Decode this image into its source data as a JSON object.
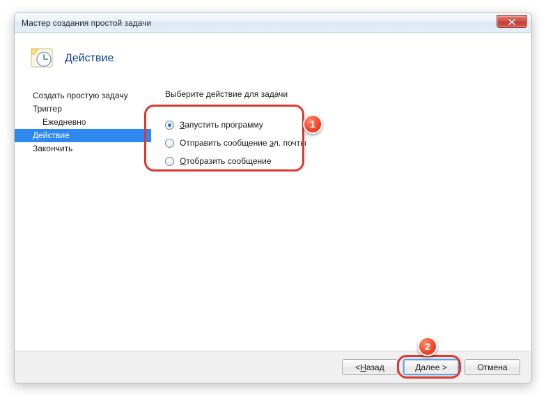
{
  "window": {
    "title": "Мастер создания простой задачи"
  },
  "header": {
    "title": "Действие"
  },
  "sidebar": {
    "items": [
      {
        "label": "Создать простую задачу",
        "sub": false,
        "selected": false
      },
      {
        "label": "Триггер",
        "sub": false,
        "selected": false
      },
      {
        "label": "Ежедневно",
        "sub": true,
        "selected": false
      },
      {
        "label": "Действие",
        "sub": false,
        "selected": true
      },
      {
        "label": "Закончить",
        "sub": false,
        "selected": false
      }
    ]
  },
  "main": {
    "instruction": "Выберите действие для задачи",
    "options": [
      {
        "prefix": "З",
        "rest": "апустить программу",
        "checked": true
      },
      {
        "prefix": "",
        "rest_before": "Отправить сообщение ",
        "ul": "э",
        "rest_after": "л. почты",
        "checked": false
      },
      {
        "prefix": "О",
        "rest": "тобразить сообщение",
        "checked": false
      }
    ]
  },
  "footer": {
    "back_ul": "Н",
    "back_rest": "азад",
    "next_ul": "Д",
    "next_rest": "алее >",
    "cancel": "Отмена"
  },
  "annotations": {
    "n1": "1",
    "n2": "2"
  }
}
